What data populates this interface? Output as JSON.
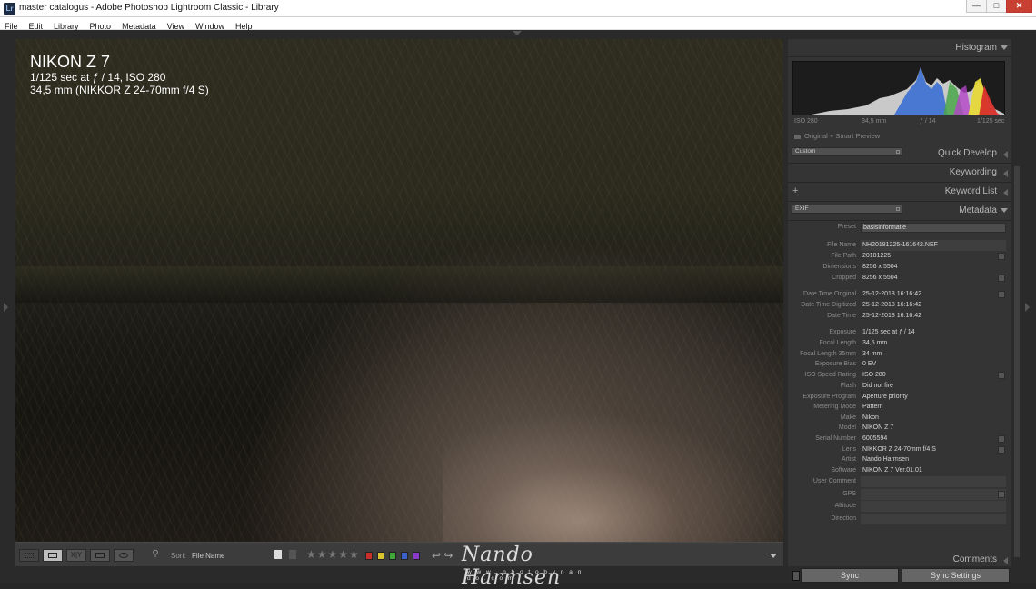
{
  "window": {
    "app_icon": "Lr",
    "title": "master catalogus - Adobe Photoshop Lightroom Classic - Library",
    "buttons": {
      "minimize": "—",
      "maximize": "□",
      "close": "✕"
    }
  },
  "menu": [
    "File",
    "Edit",
    "Library",
    "Photo",
    "Metadata",
    "View",
    "Window",
    "Help"
  ],
  "photo_info": {
    "camera": "NIKON Z 7",
    "exposure": "1/125 sec at ƒ / 14, ISO 280",
    "lens": "34,5 mm (NIKKOR Z 24-70mm f/4 S)"
  },
  "toolbar": {
    "compare_label": "X|Y",
    "sort_label": "Sort:",
    "sort_value": "File Name",
    "stars": "★★★★★",
    "rotate": "↩ ↪",
    "color_labels": [
      "#c8302a",
      "#d8c42c",
      "#3ea83a",
      "#3a62c8",
      "#8a3ac8"
    ],
    "spray_icon": "spray-can-icon"
  },
  "panels": {
    "histogram": {
      "title": "Histogram",
      "iso": "ISO 280",
      "focal": "34,5 mm",
      "aperture": "ƒ / 14",
      "shutter": "1/125 sec",
      "preview": "Original + Smart Preview"
    },
    "quick_develop": {
      "title": "Quick Develop",
      "preset": "Custom"
    },
    "keywording": {
      "title": "Keywording"
    },
    "keyword_list": {
      "title": "Keyword List",
      "add": "+"
    },
    "metadata": {
      "title": "Metadata",
      "view": "EXIF",
      "preset_label": "Preset",
      "preset_value": "basisinformatie",
      "fields": [
        {
          "k": "File Name",
          "v": "NH20181225-161642.NEF"
        },
        {
          "k": "File Path",
          "v": "20181225"
        },
        {
          "k": "Dimensions",
          "v": "8256 x 5504"
        },
        {
          "k": "Cropped",
          "v": "8256 x 5504"
        },
        {
          "k": "Date Time Original",
          "v": "25-12-2018 16:16:42"
        },
        {
          "k": "Date Time Digitized",
          "v": "25-12-2018 16:16:42"
        },
        {
          "k": "Date Time",
          "v": "25-12-2018 16:16:42"
        },
        {
          "k": "Exposure",
          "v": "1/125 sec at ƒ / 14"
        },
        {
          "k": "Focal Length",
          "v": "34,5 mm"
        },
        {
          "k": "Focal Length 35mm",
          "v": "34 mm"
        },
        {
          "k": "Exposure Bias",
          "v": "0 EV"
        },
        {
          "k": "ISO Speed Rating",
          "v": "ISO 280"
        },
        {
          "k": "Flash",
          "v": "Did not fire"
        },
        {
          "k": "Exposure Program",
          "v": "Aperture priority"
        },
        {
          "k": "Metering Mode",
          "v": "Pattern"
        },
        {
          "k": "Make",
          "v": "Nikon"
        },
        {
          "k": "Model",
          "v": "NIKON Z 7"
        },
        {
          "k": "Serial Number",
          "v": "6005594"
        },
        {
          "k": "Lens",
          "v": "NIKKOR Z 24-70mm f/4 S"
        },
        {
          "k": "Artist",
          "v": "Nando Harmsen"
        },
        {
          "k": "Software",
          "v": "NIKON Z 7 Ver.01.01"
        },
        {
          "k": "User Comment",
          "v": ""
        },
        {
          "k": "GPS",
          "v": ""
        },
        {
          "k": "Altitude",
          "v": ""
        },
        {
          "k": "Direction",
          "v": ""
        }
      ]
    },
    "comments": {
      "title": "Comments"
    }
  },
  "sync": {
    "sync": "Sync",
    "sync_settings": "Sync Settings"
  },
  "watermark": {
    "signature": "Nando Harmsen",
    "url": "w w w . p h o t o b y n a n d o . c o m"
  }
}
